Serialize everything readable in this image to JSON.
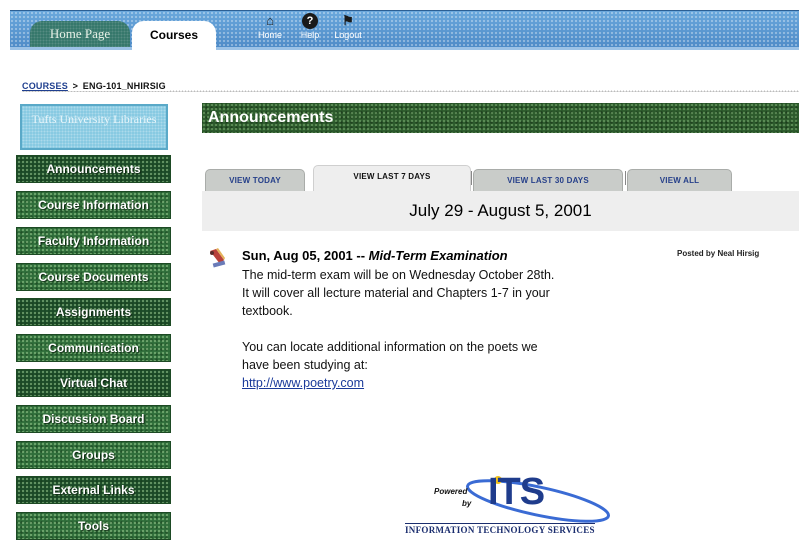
{
  "top_nav": {
    "home_tab": "Home Page",
    "courses_tab": "Courses",
    "icons": [
      {
        "icon": "home-icon",
        "label": "Home"
      },
      {
        "icon": "help-icon",
        "label": "Help"
      },
      {
        "icon": "logout-icon",
        "label": "Logout"
      }
    ]
  },
  "breadcrumb": {
    "root": "COURSES",
    "separator": ">",
    "current": "ENG-101_NHIRSIG"
  },
  "sidebar": {
    "logo_text": "Tufts University Libraries",
    "items": [
      {
        "label": "Announcements"
      },
      {
        "label": "Course Information"
      },
      {
        "label": "Faculty Information"
      },
      {
        "label": "Course Documents"
      },
      {
        "label": "Assignments"
      },
      {
        "label": "Communication"
      },
      {
        "label": "Virtual Chat"
      },
      {
        "label": "Discussion Board"
      },
      {
        "label": "Groups"
      },
      {
        "label": "External Links"
      },
      {
        "label": "Tools"
      }
    ]
  },
  "main": {
    "header": "Announcements",
    "tabs": [
      {
        "label": "VIEW TODAY"
      },
      {
        "label": "VIEW LAST 7 DAYS"
      },
      {
        "label": "VIEW LAST 30 DAYS"
      },
      {
        "label": "VIEW ALL"
      }
    ],
    "date_range": "July 29 - August 5, 2001",
    "announcement": {
      "date": "Sun, Aug 05, 2001",
      "separator": " -- ",
      "title": "Mid-Term Examination",
      "posted_by": "Posted by Neal Hirsig",
      "body_line1": "The mid-term exam will be on Wednesday October 28th.",
      "body_line2": "It will cover all lecture material and Chapters 1-7 in your",
      "body_line3": "textbook.",
      "body_line4": "You can locate additional information on the poets we",
      "body_line5": "have been studying at:",
      "link": "http://www.poetry.com"
    }
  },
  "footer": {
    "powered": "Powered",
    "by": "by",
    "its": "ITS",
    "services": "INFORMATION TECHNOLOGY SERVICES"
  },
  "colors": {
    "banner_blue": "#5b9ad4",
    "nav_green": "#2f6e3a",
    "header_green": "#2c5a2c",
    "link_blue": "#1a3a9a"
  }
}
